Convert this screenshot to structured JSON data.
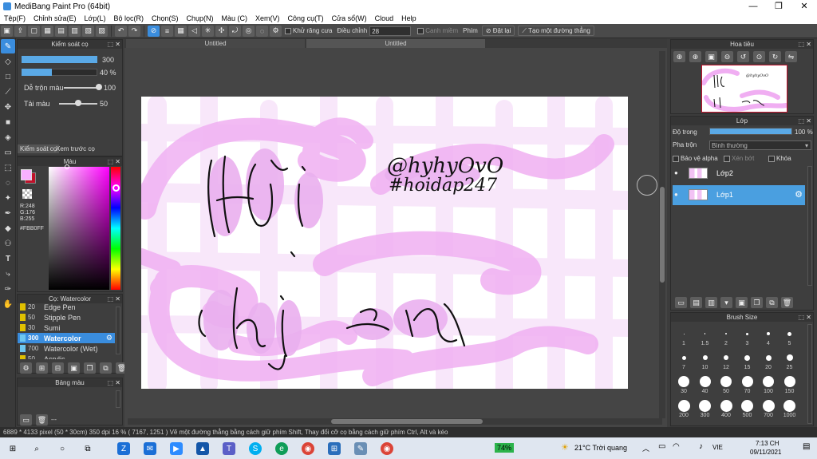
{
  "window": {
    "title": "MediBang Paint Pro (64bit)",
    "minimize": "—",
    "maximize": "❐",
    "close": "✕"
  },
  "menu": [
    "Tệp(F)",
    "Chỉnh sửa(E)",
    "Lớp(L)",
    "Bộ lọc(R)",
    "Chọn(S)",
    "Chụp(N)",
    "Màu (C)",
    "Xem(V)",
    "Công cụ(T)",
    "Cửa sổ(W)",
    "Cloud",
    "Help"
  ],
  "toolbar": {
    "antialias_label": "Khử răng cưa",
    "correction_label": "Điều chỉnh",
    "correction_value": "28",
    "edge_label": "Canh miềm",
    "key_label": "Phím",
    "reset_label": "Đặt lại",
    "create_line_label": "Tạo một đường thẳng"
  },
  "brush_control": {
    "title": "Kiểm soát cọ",
    "size_value": "300",
    "opacity_value": "40 %",
    "opacity_fraction": 0.4,
    "mix_label": "Dễ trộn màu",
    "mix_value": "100",
    "mix_fraction": 1.0,
    "reload_label": "Tải màu",
    "reload_value": "50",
    "reload_fraction": 0.5,
    "tab_brush": "Kiểm soát cọ",
    "tab_preview": "Xem trước cọ"
  },
  "color_panel": {
    "title": "Màu",
    "r": "R:248",
    "g": "G:176",
    "b": "B:255",
    "hex": "#FBB0FF",
    "fg_color": "#f8b0ff",
    "bg_color": "#c0102a"
  },
  "brush_panel": {
    "title": "Cọ: Watercolor",
    "items": [
      {
        "size": "20",
        "name": "Edge Pen",
        "color": "#e0c000",
        "selected": false
      },
      {
        "size": "50",
        "name": "Stipple Pen",
        "color": "#e0c000",
        "selected": false
      },
      {
        "size": "30",
        "name": "Sumi",
        "color": "#e0c000",
        "selected": false
      },
      {
        "size": "300",
        "name": "Watercolor",
        "color": "#6ec8f0",
        "selected": true
      },
      {
        "size": "700",
        "name": "Watercolor (Wet)",
        "color": "#6ec8f0",
        "selected": false
      },
      {
        "size": "50",
        "name": "Acrylic",
        "color": "#e0c000",
        "selected": false
      }
    ]
  },
  "palette_panel": {
    "title": "Bảng màu",
    "counter": "---"
  },
  "documents": {
    "tab1": "Untitled",
    "tab2": "Untitled"
  },
  "canvas_text": {
    "handle1": "@hyhyOvO",
    "handle2": "#hoidap247",
    "word1": "Hỏi",
    "word2": "chị",
    "word3": "em"
  },
  "navigator": {
    "title": "Hoa tiêu"
  },
  "layer_panel": {
    "title": "Lớp",
    "opacity_label": "Độ trong",
    "opacity_value": "100 %",
    "opacity_fraction": 1.0,
    "blend_label": "Pha trộn",
    "blend_value": "Bình thường",
    "protect_alpha": "Bảo vệ alpha",
    "clipping": "Xén bớt",
    "lock": "Khóa",
    "layers": [
      {
        "name": "Lớp2",
        "selected": false
      },
      {
        "name": "Lớp1",
        "selected": true
      }
    ]
  },
  "brush_size_panel": {
    "title": "Brush Size",
    "sizes": [
      "1",
      "1.5",
      "2",
      "3",
      "4",
      "5",
      "7",
      "10",
      "12",
      "15",
      "20",
      "25",
      "30",
      "40",
      "50",
      "70",
      "100",
      "150",
      "200",
      "300",
      "400",
      "500",
      "700",
      "1000"
    ]
  },
  "status_bar": {
    "text": "6889 * 4133 pixel  (50 * 30cm)  350 dpi  16 %  ( 7167, 1251 )  Vẽ một đường thẳng bằng cách giữ phím Shift, Thay đổi cỡ cọ bằng cách giữ phím Ctrl, Alt và kéo"
  },
  "taskbar": {
    "battery": "74%",
    "weather": "21°C  Trời quang",
    "lang": "VIE",
    "time": "7:13 CH",
    "date": "09/11/2021"
  }
}
